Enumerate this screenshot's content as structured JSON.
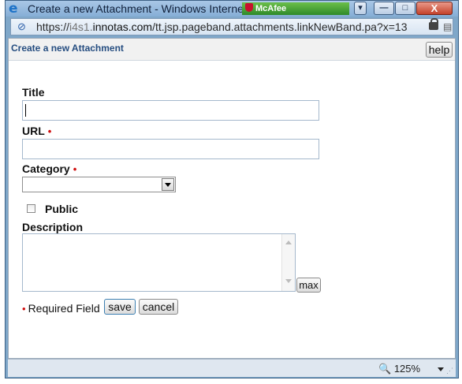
{
  "window": {
    "title": "Create a new Attachment - Windows Internet E",
    "mcafee_label": "McAfee",
    "controls": {
      "dropdown": "▾",
      "minimize": "—",
      "maximize": "□",
      "close": "X"
    }
  },
  "address": {
    "prefix": "https://",
    "subdomain": "i4s1.",
    "domain": "innotas.com",
    "path": "/tt.jsp.pageband.attachments.linkNewBand.pa?x=13",
    "icons": {
      "page": "page-icon",
      "lock": "lock-icon",
      "compat": "compatibility-icon"
    }
  },
  "page": {
    "header_title": "Create a new Attachment",
    "help_label": "help",
    "required_marker": "•",
    "title_label": "Title",
    "title_value": "",
    "url_label": "URL",
    "url_value": "",
    "category_label": "Category",
    "category_value": "",
    "public_label": "Public",
    "public_checked": false,
    "description_label": "Description",
    "description_value": "",
    "max_label": "max",
    "required_field_text": "Required Field",
    "save_label": "save",
    "cancel_label": "cancel"
  },
  "status": {
    "zoom": "125%"
  }
}
